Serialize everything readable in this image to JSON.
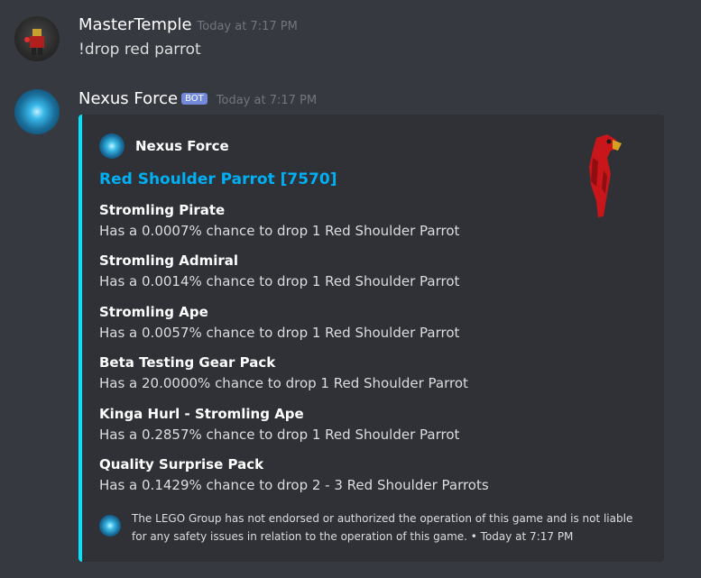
{
  "messages": [
    {
      "author": "MasterTemple",
      "timestamp": "Today at 7:17 PM",
      "content": "!drop red parrot"
    },
    {
      "author": "Nexus Force",
      "bot_tag": "BOT",
      "timestamp": "Today at 7:17 PM"
    }
  ],
  "embed": {
    "accent_color": "#00e5ff",
    "author": "Nexus Force",
    "title": "Red Shoulder Parrot [7570]",
    "fields": [
      {
        "name": "Stromling Pirate",
        "value": "Has a 0.0007% chance to drop 1 Red Shoulder Parrot"
      },
      {
        "name": "Stromling Admiral",
        "value": "Has a 0.0014% chance to drop 1 Red Shoulder Parrot"
      },
      {
        "name": "Stromling Ape",
        "value": "Has a 0.0057% chance to drop 1 Red Shoulder Parrot"
      },
      {
        "name": "Beta Testing Gear Pack",
        "value": "Has a 20.0000% chance to drop 1 Red Shoulder Parrot"
      },
      {
        "name": "Kinga Hurl - Stromling Ape",
        "value": "Has a 0.2857% chance to drop 1 Red Shoulder Parrot"
      },
      {
        "name": "Quality Surprise Pack",
        "value": "Has a 0.1429% chance to drop 2 - 3 Red Shoulder Parrots"
      }
    ],
    "footer": "The LEGO Group has not endorsed or authorized the operation of this game and is not liable for any safety issues in relation to the operation of this game. • Today at 7:17 PM"
  }
}
